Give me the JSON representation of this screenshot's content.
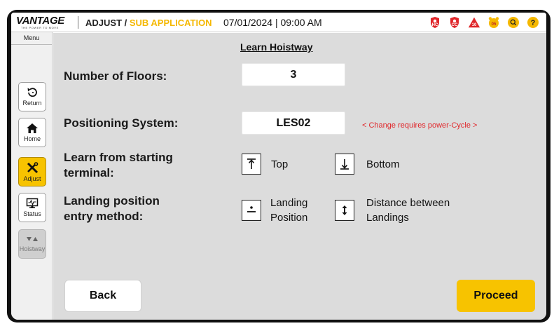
{
  "header": {
    "logo_text": "VANTAGE",
    "logo_tagline": "THE POWER TO MOVE",
    "breadcrumb_main": "ADJUST / ",
    "breadcrumb_sub": "SUB APPLICATION",
    "datetime": "07/01/2024 | 09:00 AM",
    "status_icons": [
      {
        "name": "hc-alert-icon",
        "text": "HC",
        "color": "#e0262a"
      },
      {
        "name": "cc-alert-icon",
        "text": "CC",
        "color": "#e0262a"
      },
      {
        "name": "warning-count-icon",
        "text": "10",
        "color": "#e0262a"
      },
      {
        "name": "alarm-clock-icon",
        "text": "05",
        "color": "#f5b800"
      },
      {
        "name": "search-icon",
        "text": "",
        "color": "#f5b800"
      },
      {
        "name": "help-icon",
        "text": "?",
        "color": "#f5b800"
      }
    ]
  },
  "sidebar": {
    "menu_label": "Menu",
    "items": [
      {
        "label": "Return",
        "icon": "return-icon",
        "state": "normal"
      },
      {
        "label": "Home",
        "icon": "home-icon",
        "state": "normal"
      },
      {
        "label": "Adjust",
        "icon": "tools-icon",
        "state": "active"
      },
      {
        "label": "Status",
        "icon": "status-monitor-icon",
        "state": "normal"
      },
      {
        "label": "Hoistway",
        "icon": "hoistway-icon",
        "state": "disabled"
      }
    ]
  },
  "main": {
    "title": "Learn Hoistway",
    "floors_label": "Number of Floors:",
    "floors_value": "3",
    "positioning_label": "Positioning System:",
    "positioning_value": "LES02",
    "positioning_note": "< Change requires power-Cycle >",
    "terminal_label_line1": "Learn from starting",
    "terminal_label_line2": "terminal:",
    "terminal_options": [
      {
        "label": "Top",
        "icon": "arrow-up-bar-icon"
      },
      {
        "label": "Bottom",
        "icon": "arrow-down-bar-icon"
      }
    ],
    "landing_label_line1": "Landing position",
    "landing_label_line2": "entry method:",
    "landing_options": [
      {
        "label_line1": "Landing",
        "label_line2": "Position",
        "icon": "landing-position-icon"
      },
      {
        "label_line1": "Distance between",
        "label_line2": "Landings",
        "icon": "distance-arrows-icon"
      }
    ],
    "back_label": "Back",
    "proceed_label": "Proceed"
  }
}
